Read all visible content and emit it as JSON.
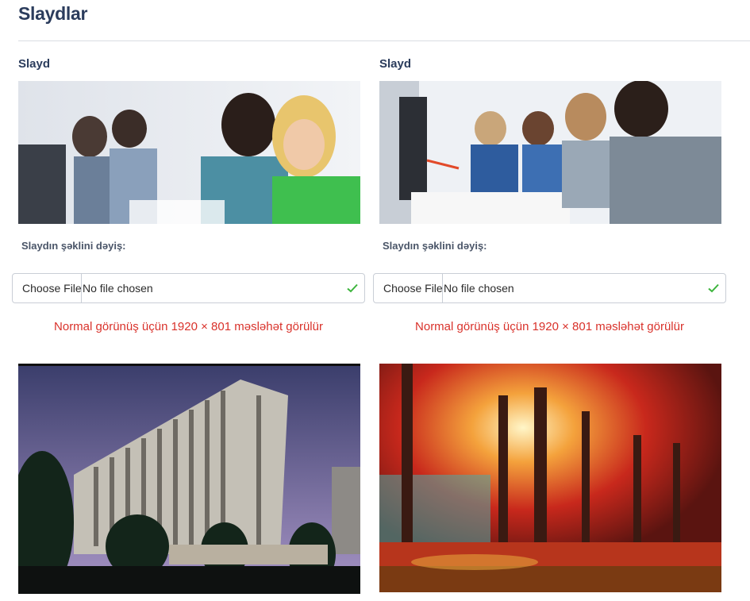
{
  "page": {
    "title": "Slaydlar"
  },
  "slides": [
    {
      "label": "Slayd",
      "change_label": "Slaydın şəklini dəyiş:",
      "file_button": "Choose File",
      "file_status": "No file chosen",
      "hint": "Normal görünüş üçün 1920 × 801 məsləhət görülür"
    },
    {
      "label": "Slayd",
      "change_label": "Slaydın şəklini dəyiş:",
      "file_button": "Choose File",
      "file_status": "No file chosen",
      "hint": "Normal görünüş üçün 1920 × 801 məsləhət görülür"
    }
  ],
  "icons": {
    "valid": "check-icon"
  },
  "colors": {
    "title": "#2b3c5c",
    "hint": "#d9322b",
    "check": "#3cb43c"
  }
}
